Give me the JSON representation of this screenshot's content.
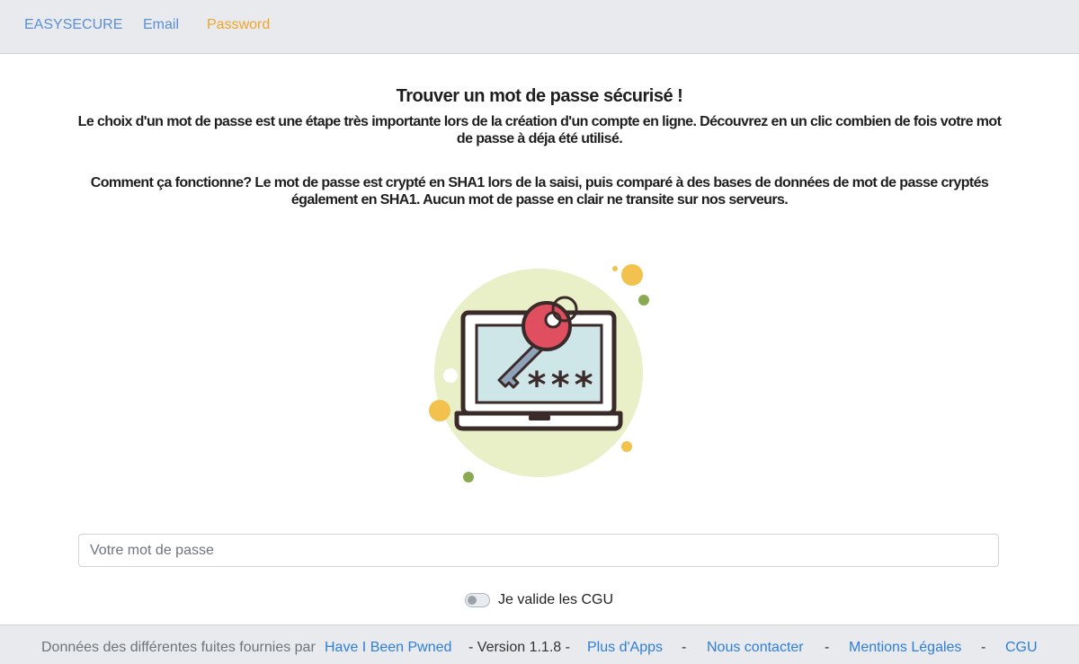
{
  "nav": {
    "brand": "EASYSECURE",
    "email": "Email",
    "password": "Password"
  },
  "main": {
    "title": "Trouver un mot de passe sécurisé !",
    "intro": "Le choix d'un mot de passe est une étape très importante lors de la création d'un compte en ligne. Découvrez en un clic combien de fois votre mot de passe à déja été utilisé.",
    "how_it_works": "Comment ça fonctionne? Le mot de passe est crypté en SHA1 lors de la saisi, puis comparé à des bases de données de mot de passe cryptés également en SHA1. Aucun mot de passe en clair ne transite sur nos serveurs.",
    "password_placeholder": "Votre mot de passe",
    "password_value": "",
    "cgu_label": "Je valide les CGU",
    "cgu_checked": false,
    "illustration": {
      "icon": "laptop-key-icon",
      "masked_text": "***",
      "colors": {
        "halo": "#e9f0c8",
        "key": "#e04f5f",
        "screen": "#cfe6e8",
        "dot_yellow": "#f2c14e",
        "dot_green": "#8aaa52",
        "outline": "#3b2a2a"
      }
    }
  },
  "footer": {
    "source_text": "Données des différentes fuites fournies par",
    "source_link": "Have I Been Pwned",
    "version": "- Version 1.1.8 -",
    "apps_link": "Plus d'Apps",
    "sep1": "-",
    "contact_link": "Nous contacter",
    "sep2": "-",
    "legal_link": "Mentions Légales",
    "sep3": "-",
    "cgu_link": "CGU"
  },
  "colors": {
    "nav_bg": "#e8eaed",
    "link_blue": "#5b8fd6",
    "active_orange": "#f0a42b",
    "footer_link": "#2f7fd8"
  }
}
